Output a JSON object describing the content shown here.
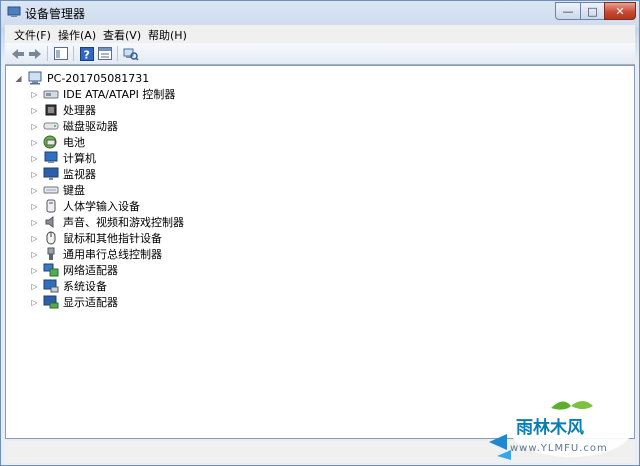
{
  "window": {
    "title": "设备管理器",
    "minimize": "—",
    "maximize": "□",
    "close": "✕"
  },
  "menu": [
    "文件(F)",
    "操作(A)",
    "查看(V)",
    "帮助(H)"
  ],
  "tree": {
    "root": "PC-201705081731",
    "items": [
      {
        "label": "IDE ATA/ATAPI 控制器",
        "icon": "ide-controller-icon"
      },
      {
        "label": "处理器",
        "icon": "processor-icon"
      },
      {
        "label": "磁盘驱动器",
        "icon": "disk-drive-icon"
      },
      {
        "label": "电池",
        "icon": "battery-icon"
      },
      {
        "label": "计算机",
        "icon": "computer-icon"
      },
      {
        "label": "监视器",
        "icon": "monitor-icon"
      },
      {
        "label": "键盘",
        "icon": "keyboard-icon"
      },
      {
        "label": "人体学输入设备",
        "icon": "hid-icon"
      },
      {
        "label": "声音、视频和游戏控制器",
        "icon": "sound-icon"
      },
      {
        "label": "鼠标和其他指针设备",
        "icon": "mouse-icon"
      },
      {
        "label": "通用串行总线控制器",
        "icon": "usb-icon"
      },
      {
        "label": "网络适配器",
        "icon": "network-adapter-icon"
      },
      {
        "label": "系统设备",
        "icon": "system-devices-icon"
      },
      {
        "label": "显示适配器",
        "icon": "display-adapter-icon"
      }
    ]
  },
  "watermark": {
    "text": "雨林木风",
    "url": "www.YLMFU.com"
  }
}
